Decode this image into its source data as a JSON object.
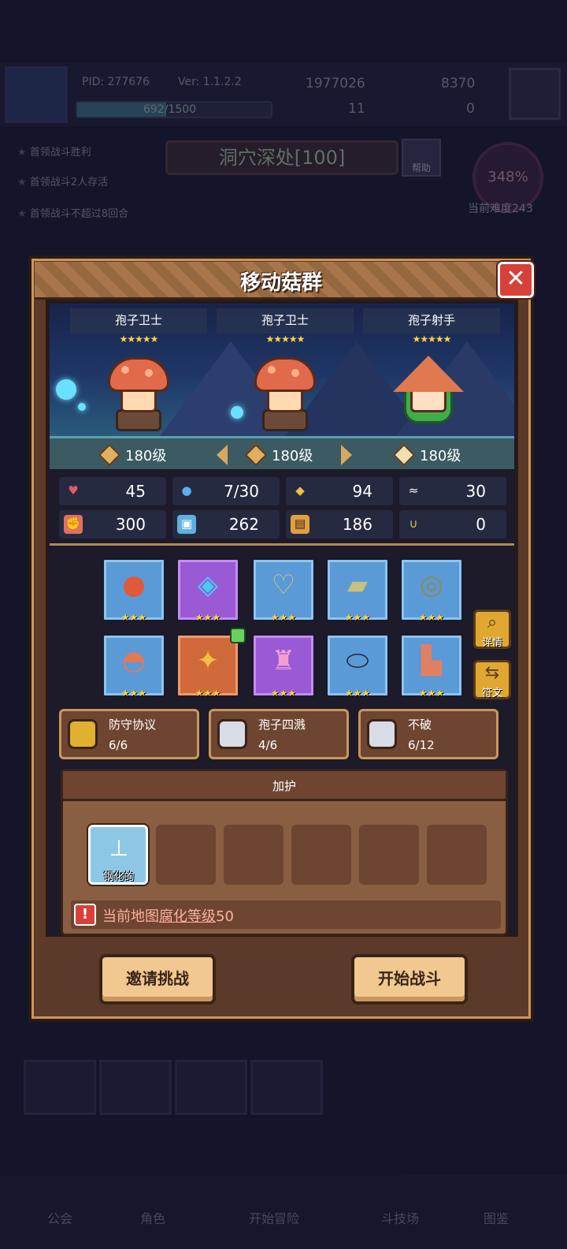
{
  "background": {
    "pid": "PID: 277676",
    "version": "Ver: 1.1.2.2",
    "gold": "1977026",
    "gems": "8370",
    "xp": "692/1500",
    "clover": "11",
    "keys": "0",
    "quests": [
      "首领战斗胜利",
      "首领战斗2人存活",
      "首领战斗不超过8回合"
    ],
    "stage": "洞穴深处[100]",
    "help": "帮助",
    "difficulty_pct": "348%",
    "difficulty_label": "当前难度243",
    "nav": [
      "公会",
      "角色",
      "开始冒险",
      "斗技场",
      "图鉴"
    ]
  },
  "modal": {
    "title": "移动菇群",
    "close_icon": "close-icon",
    "monsters": [
      {
        "name": "孢子卫士",
        "stars": "★★★★★",
        "level": "180级"
      },
      {
        "name": "孢子卫士",
        "stars": "★★★★★",
        "level": "180级"
      },
      {
        "name": "孢子射手",
        "stars": "★★★★★",
        "level": "180级"
      }
    ],
    "stats": [
      {
        "icon": "heart-icon",
        "value": "45",
        "color": "#e05a6a"
      },
      {
        "icon": "mana-drop-icon",
        "value": "7/30",
        "color": "#5ab0f0"
      },
      {
        "icon": "shield-icon",
        "value": "94",
        "color": "#f0c040"
      },
      {
        "icon": "wing-icon",
        "value": "30",
        "color": "#ffffff"
      },
      {
        "icon": "fist-icon",
        "value": "300",
        "color": "#e07060"
      },
      {
        "icon": "spellbook-icon",
        "value": "262",
        "color": "#60b0e0"
      },
      {
        "icon": "armor-icon",
        "value": "186",
        "color": "#e0a040"
      },
      {
        "icon": "horseshoe-icon",
        "value": "0",
        "color": "#f0c040"
      }
    ],
    "equipment": [
      {
        "name": "red-orb-icon",
        "rarity": "blue",
        "stars": "★★★"
      },
      {
        "name": "crystal-tome-icon",
        "rarity": "purple",
        "stars": "★★★"
      },
      {
        "name": "necklace-icon",
        "rarity": "blue",
        "stars": "★★★"
      },
      {
        "name": "bracer-icon",
        "rarity": "blue",
        "stars": "★★★"
      },
      {
        "name": "ring-icon",
        "rarity": "blue",
        "stars": "★★★"
      },
      {
        "name": "mushroom-hat-icon",
        "rarity": "blue",
        "stars": "★★★"
      },
      {
        "name": "golden-armor-icon",
        "rarity": "orange",
        "stars": "★★★"
      },
      {
        "name": "pink-robe-icon",
        "rarity": "purple",
        "stars": "★★★"
      },
      {
        "name": "belt-icon",
        "rarity": "blue",
        "stars": "★★★"
      },
      {
        "name": "boots-icon",
        "rarity": "blue",
        "stars": "★★★"
      }
    ],
    "details_label": "详情",
    "runes_label": "符文",
    "sets": [
      {
        "name": "防守协议",
        "progress": "6/6",
        "color": "#e0b030"
      },
      {
        "name": "孢子四溅",
        "progress": "4/6",
        "color": "#d8dce6"
      },
      {
        "name": "不破",
        "progress": "6/12",
        "color": "#d8dce6"
      }
    ],
    "blessing": {
      "title": "加护",
      "slots": [
        {
          "label": "钢化的",
          "icon": "anvil-icon"
        },
        {},
        {},
        {},
        {},
        {}
      ],
      "warning_prefix": "当前地图",
      "warning_link": "腐化等级",
      "warning_suffix": "50"
    },
    "invite_button": "邀请挑战",
    "start_button": "开始战斗"
  }
}
